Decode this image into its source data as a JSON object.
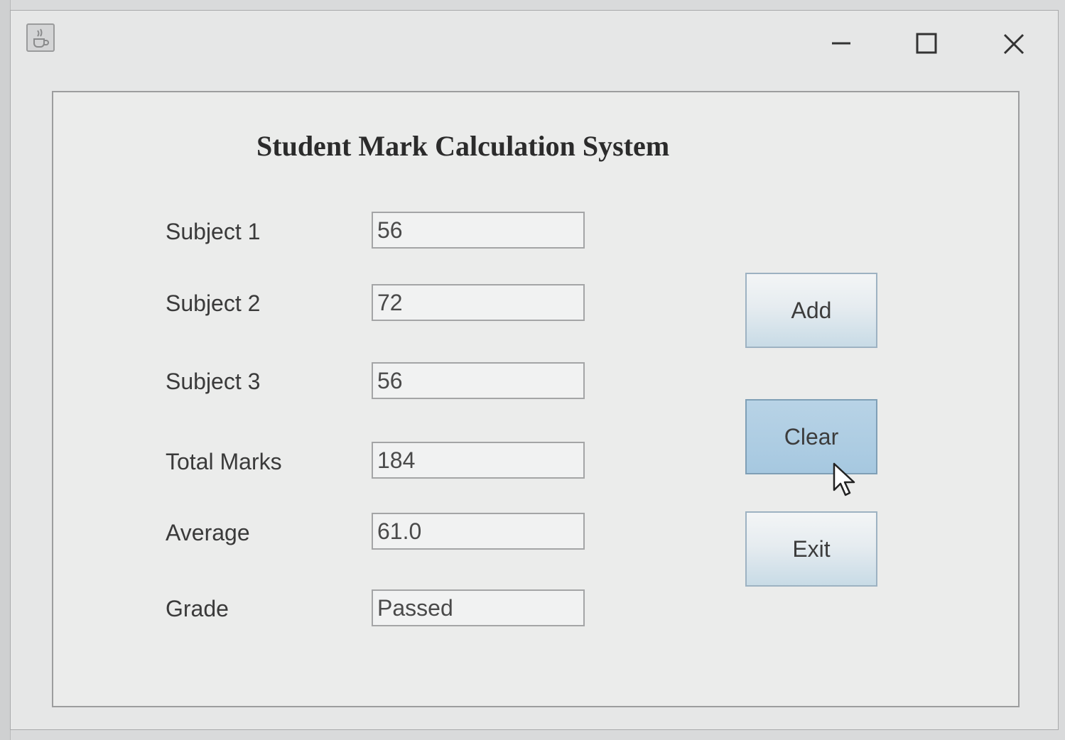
{
  "window": {
    "app_icon": "java-coffee-cup-icon",
    "controls": {
      "minimize": "minimize-icon",
      "maximize": "maximize-icon",
      "close": "close-icon"
    }
  },
  "form": {
    "heading": "Student Mark Calculation System",
    "fields": [
      {
        "label": "Subject 1",
        "value": "56"
      },
      {
        "label": "Subject 2",
        "value": "72"
      },
      {
        "label": "Subject 3",
        "value": "56"
      },
      {
        "label": "Total Marks",
        "value": "184"
      },
      {
        "label": "Average",
        "value": "61.0"
      },
      {
        "label": "Grade",
        "value": "Passed"
      }
    ]
  },
  "buttons": {
    "add": "Add",
    "clear": "Clear",
    "exit": "Exit"
  },
  "state": {
    "pressed_button": "clear",
    "pointer": "arrow-cursor-icon"
  }
}
